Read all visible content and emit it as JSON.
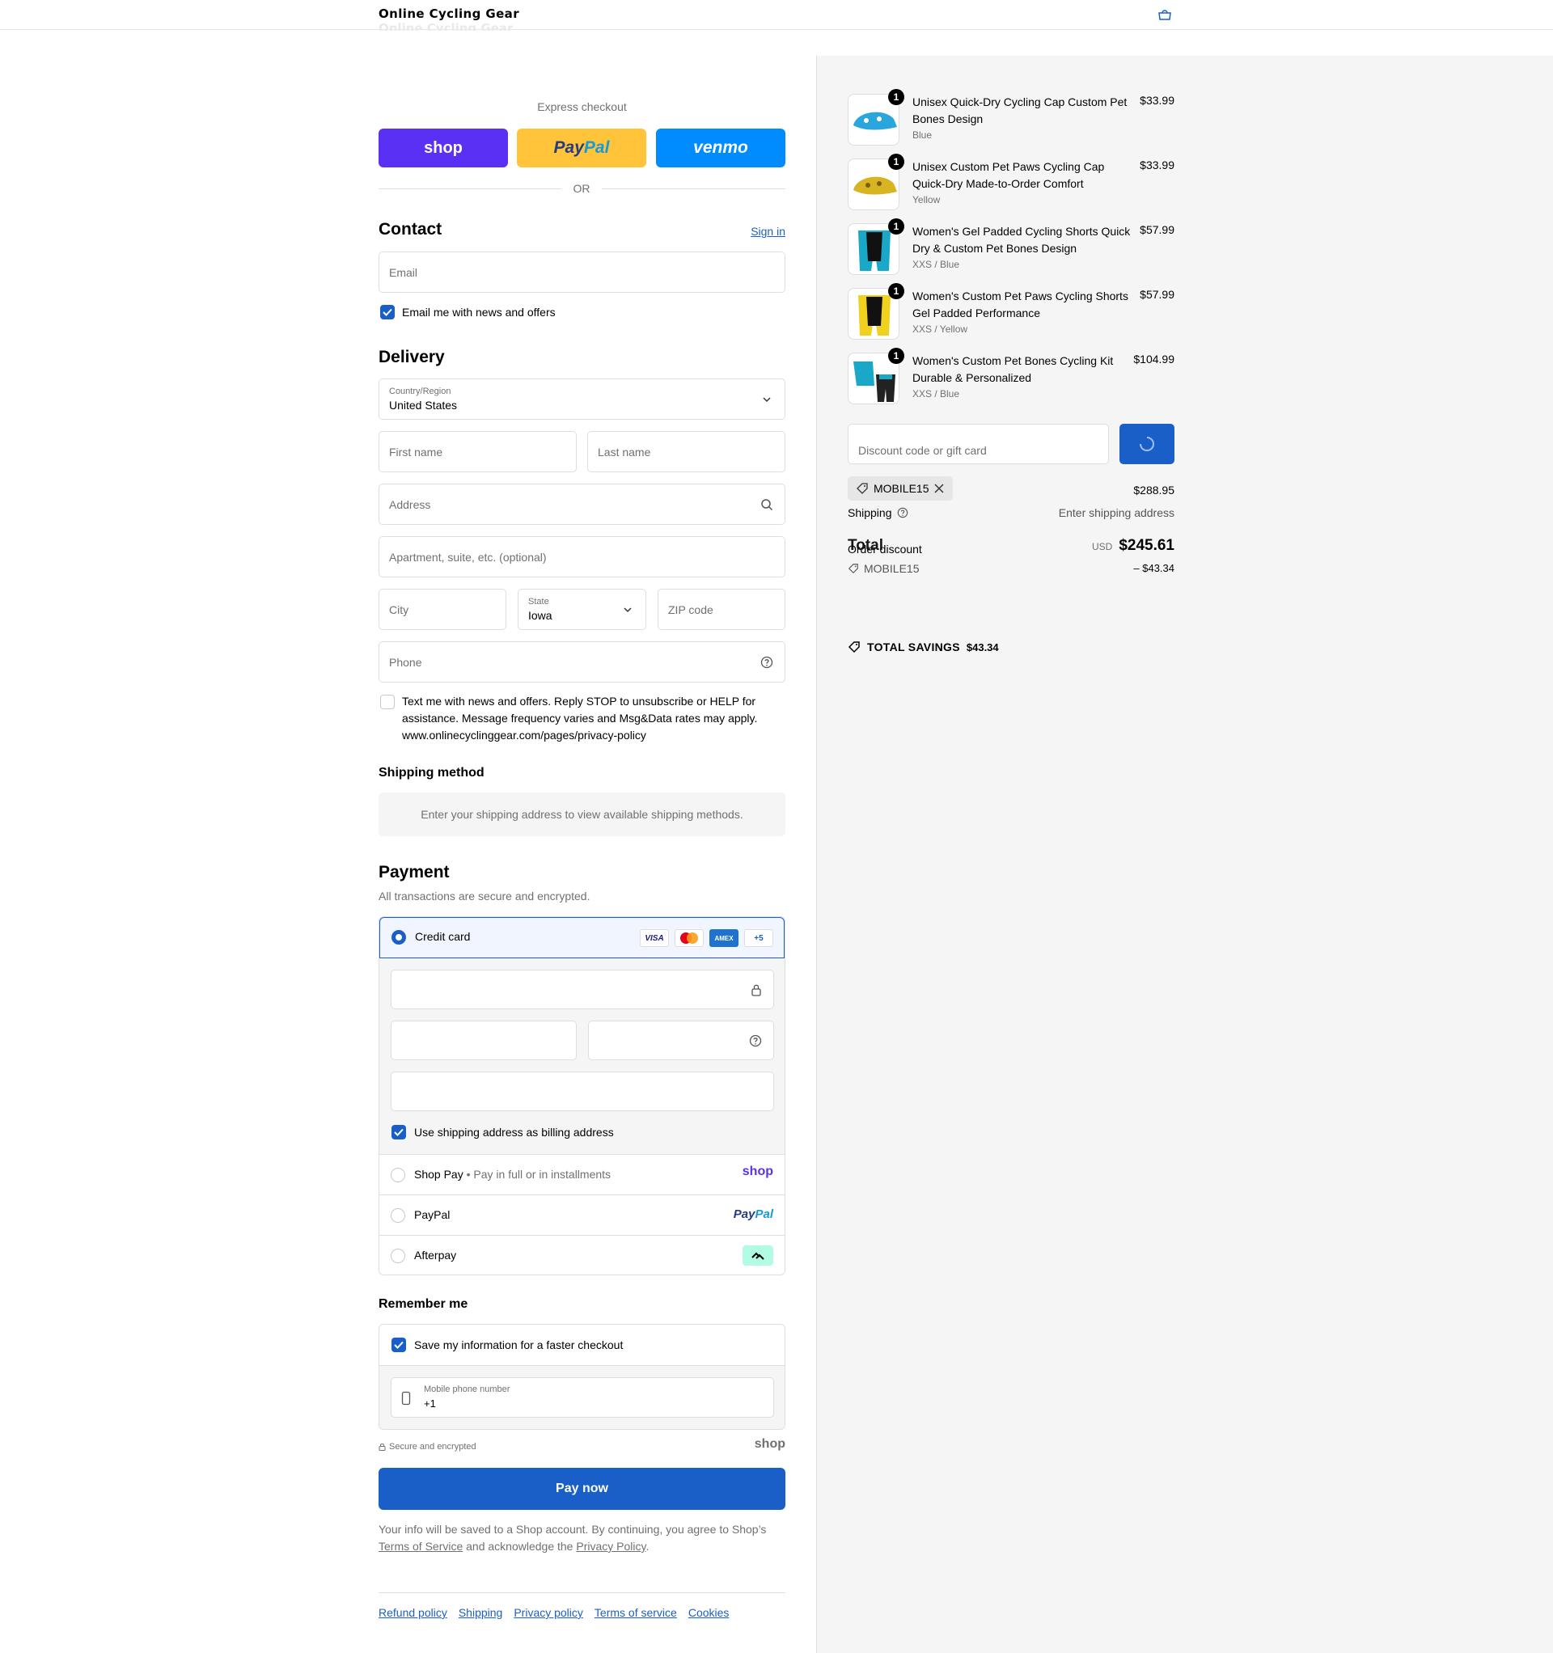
{
  "store": {
    "name": "Online Cycling Gear"
  },
  "express": {
    "label": "Express checkout",
    "or": "OR",
    "shop": "shop",
    "paypal_pay": "Pay",
    "paypal_pal": "Pal",
    "venmo": "venmo"
  },
  "contact": {
    "title": "Contact",
    "sign_in": "Sign in",
    "email_placeholder": "Email",
    "news_label": "Email me with news and offers"
  },
  "delivery": {
    "title": "Delivery",
    "country_label": "Country/Region",
    "country_value": "United States",
    "first_name": "First name",
    "last_name": "Last name",
    "address": "Address",
    "apartment": "Apartment, suite, etc. (optional)",
    "city": "City",
    "state_label": "State",
    "state_value": "Iowa",
    "zip": "ZIP code",
    "phone": "Phone",
    "sms_text": "Text me with news and offers. Reply STOP to unsubscribe or HELP for assistance. Message frequency varies and Msg&Data rates may apply. www.onlinecyclinggear.com/pages/privacy-policy"
  },
  "shipping_method": {
    "title": "Shipping method",
    "message": "Enter your shipping address to view available shipping methods."
  },
  "payment": {
    "title": "Payment",
    "subtitle": "All transactions are secure and encrypted.",
    "credit_card": "Credit card",
    "visa": "VISA",
    "amex": "AMEX",
    "more": "+5",
    "billing_label": "Use shipping address as billing address",
    "shop_pay": "Shop Pay",
    "shop_pay_sub": "Pay in full or in installments",
    "shop_logo": "shop",
    "paypal": "PayPal",
    "paypal_pay": "Pay",
    "paypal_pal": "Pal",
    "afterpay": "Afterpay"
  },
  "remember": {
    "title": "Remember me",
    "save_label": "Save my information for a faster checkout",
    "phone_label": "Mobile phone number",
    "phone_value": "+1",
    "secure": "Secure and encrypted",
    "shop_logo": "shop"
  },
  "pay_now": "Pay now",
  "disclaimer": {
    "pre": "Your info will be saved to a Shop account. By continuing, you agree to Shop’s ",
    "tos": "Terms of Service",
    "mid": " and acknowledge the ",
    "privacy": "Privacy Policy",
    "post": "."
  },
  "footer_links": [
    "Refund policy",
    "Shipping",
    "Privacy policy",
    "Terms of service",
    "Cookies"
  ],
  "cart": {
    "items": [
      {
        "name": "Unisex Quick-Dry Cycling Cap Custom Pet Bones Design",
        "variant": "Blue",
        "price": "$33.99",
        "qty": "1"
      },
      {
        "name": "Unisex Custom Pet Paws Cycling Cap Quick-Dry Made-to-Order Comfort",
        "variant": "Yellow",
        "price": "$33.99",
        "qty": "1"
      },
      {
        "name": "Women's Gel Padded Cycling Shorts Quick Dry & Custom Pet Bones Design",
        "variant": "XXS / Blue",
        "price": "$57.99",
        "qty": "1"
      },
      {
        "name": "Women's Custom Pet Paws Cycling Shorts Gel Padded Performance",
        "variant": "XXS / Yellow",
        "price": "$57.99",
        "qty": "1"
      },
      {
        "name": "Women's Custom Pet Bones Cycling Kit Durable & Personalized",
        "variant": "XXS / Blue",
        "price": "$104.99",
        "qty": "1"
      }
    ],
    "discount_placeholder": "Discount code or gift card",
    "code": "MOBILE15",
    "subtotal": "$288.95",
    "shipping_label": "Shipping",
    "shipping_value": "Enter shipping address",
    "order_discount_label": "Order discount",
    "total_label": "Total",
    "currency": "USD",
    "total": "$245.61",
    "discount_code": "MOBILE15",
    "discount_amount": "– $43.34",
    "savings_label": "TOTAL SAVINGS",
    "savings_value": "$43.34"
  },
  "colors": {
    "accent": "#1a5fc7",
    "shop_purple": "#5a31f4",
    "paypal_yellow": "#ffc439",
    "venmo_blue": "#008cff",
    "afterpay_mint": "#b2fce4"
  }
}
